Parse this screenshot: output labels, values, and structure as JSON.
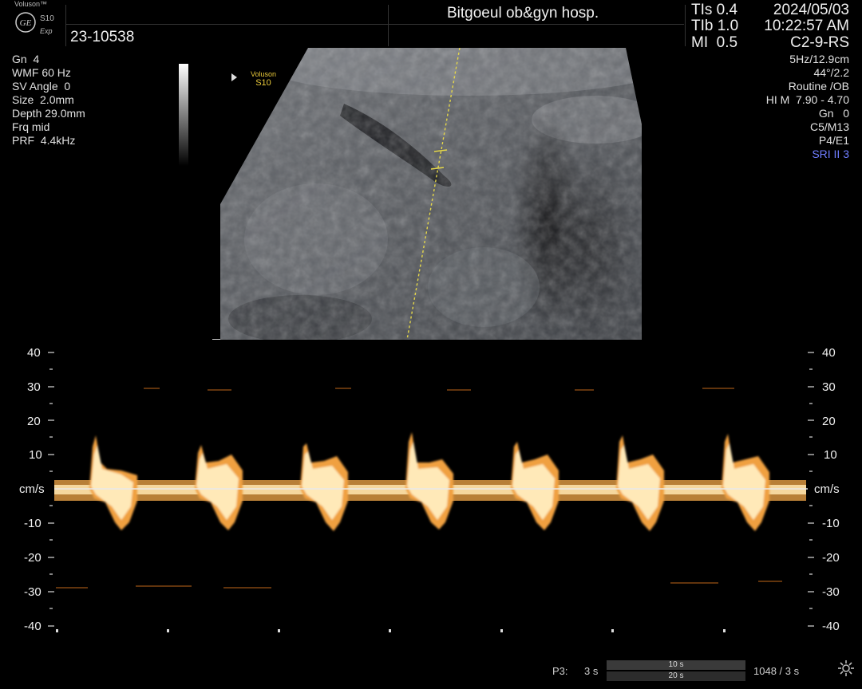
{
  "header": {
    "brand": "Voluson™",
    "model": "S10",
    "model_sub": "Exp",
    "logo_text": "GE",
    "patient_id": "23-10538",
    "hospital": "Bitgoeul ob&gyn hosp.",
    "tis_label": "TIs",
    "tis_value": "0.4",
    "tib_label": "TIb",
    "tib_value": "1.0",
    "mi_label": "MI",
    "mi_value": "0.5",
    "date": "2024/05/03",
    "time": "10:22:57 AM",
    "probe": "C2-9-RS"
  },
  "left_params": [
    "Gn  4",
    "WMF 60 Hz",
    "SV Angle  0",
    "Size  2.0mm",
    "Depth 29.0mm",
    "Frq mid",
    "PRF  4.4kHz"
  ],
  "right_params": [
    "5Hz/12.9cm",
    "44°/2.2",
    "Routine /OB",
    "HI M  7.90 - 4.70",
    "Gn   0",
    "C5/M13",
    "P4/E1",
    "SRI II 3"
  ],
  "image_label": {
    "line1": "Voluson",
    "line2": "S10"
  },
  "spectrum": {
    "unit": "cm/s",
    "scale_left": [
      "40",
      "30",
      "20",
      "10",
      "-10",
      "-20",
      "-30",
      "-40"
    ],
    "scale_right": [
      "40",
      "30",
      "20",
      "10",
      "-10",
      "-20",
      "-30",
      "-40"
    ]
  },
  "bottom": {
    "p3_label": "P3:",
    "p3_value": "3 s",
    "bar1": "10 s",
    "bar2": "20 s",
    "counter": "1048 / 3 s"
  },
  "colors": {
    "accent_blue": "#6f7dff",
    "doppler_core": "#fff0c8",
    "doppler_mid": "#f5a94a",
    "doppler_edge": "#8a4a12"
  }
}
